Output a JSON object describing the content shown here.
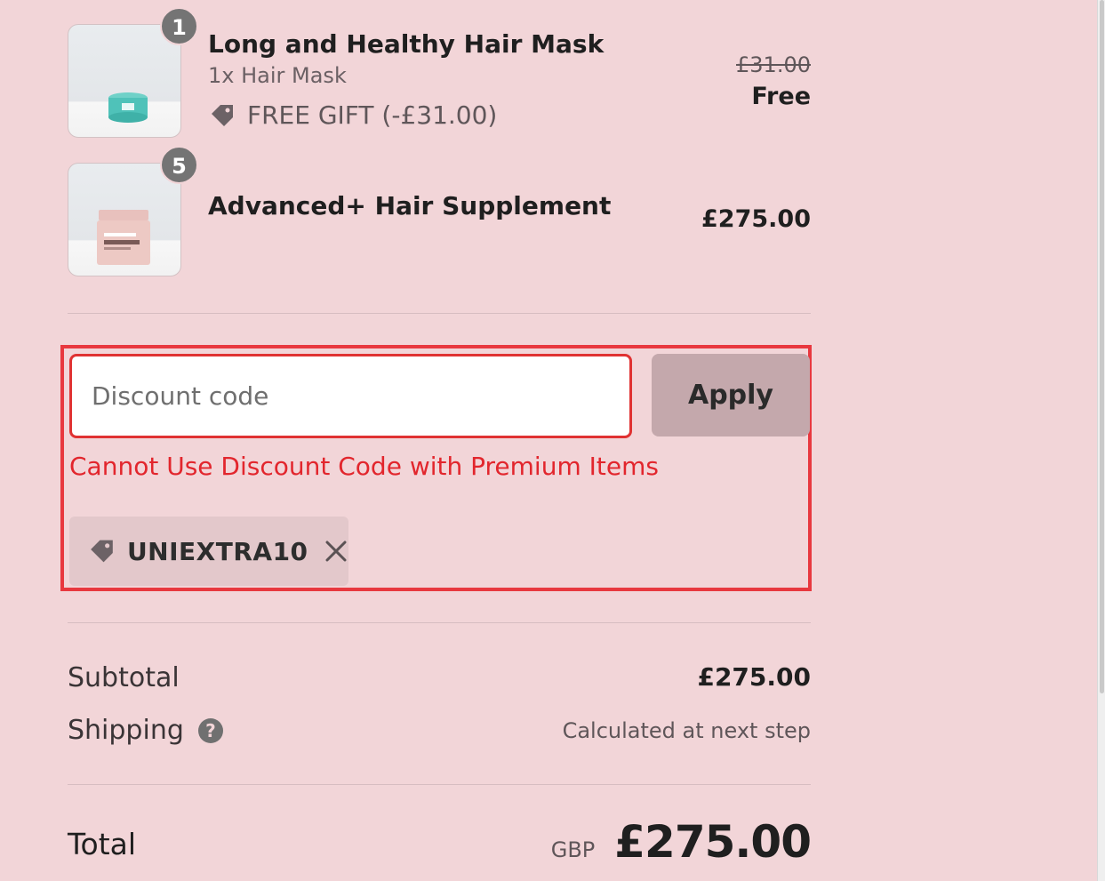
{
  "items": [
    {
      "quantity": "1",
      "title": "Long and Healthy Hair Mask",
      "variant": "1x Hair Mask",
      "gift_label": "FREE GIFT (-£31.00)",
      "original_price": "£31.00",
      "price": "Free",
      "image_icon": "teal-jar-icon"
    },
    {
      "quantity": "5",
      "title": "Advanced+ Hair Supplement",
      "price": "£275.00",
      "image_icon": "pink-jar-icon"
    }
  ],
  "discount": {
    "placeholder": "Discount code",
    "value": "",
    "apply_label": "Apply",
    "error": "Cannot Use Discount Code with Premium Items",
    "applied_code": "UNIEXTRA10",
    "tag_icon": "tag-icon",
    "remove_icon": "close-icon"
  },
  "summary": {
    "subtotal_label": "Subtotal",
    "subtotal_value": "£275.00",
    "shipping_label": "Shipping",
    "shipping_help_icon": "help-icon",
    "shipping_value": "Calculated at next step",
    "total_label": "Total",
    "currency": "GBP",
    "total_value": "£275.00"
  },
  "colors": {
    "background": "#f2d5d8",
    "error": "#e2262d",
    "highlight_border": "#e8383f",
    "apply_button": "#c4a8ac"
  }
}
